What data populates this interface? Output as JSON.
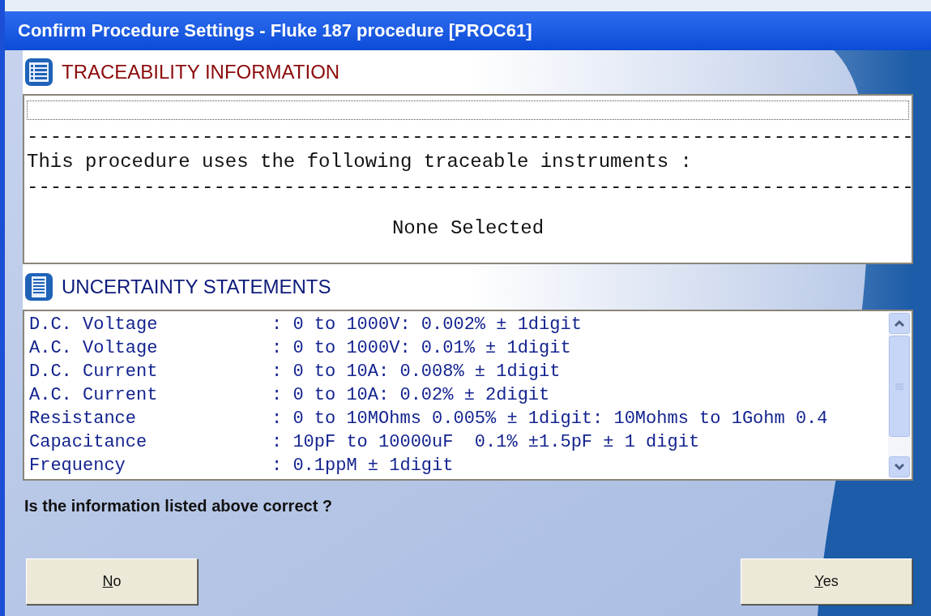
{
  "window": {
    "title": "Confirm Procedure Settings - Fluke 187 procedure [PROC61]"
  },
  "traceability": {
    "heading": "TRACEABILITY INFORMATION",
    "lines": [
      {
        "kind": "focus"
      },
      {
        "kind": "rule",
        "text": "----------------------------------------------------------------------------"
      },
      {
        "kind": "text",
        "text": "This procedure uses the following traceable instruments :"
      },
      {
        "kind": "rule",
        "text": "----------------------------------------------------------------------------"
      },
      {
        "kind": "center",
        "text": "None Selected"
      }
    ]
  },
  "uncertainty": {
    "heading": "UNCERTAINTY STATEMENTS",
    "rows": [
      {
        "label": "D.C. Voltage",
        "value": ": 0 to 1000V: 0.002% ± 1digit"
      },
      {
        "label": "A.C. Voltage",
        "value": ": 0 to 1000V: 0.01% ± 1digit"
      },
      {
        "label": "D.C. Current",
        "value": ": 0 to 10A: 0.008% ± 1digit"
      },
      {
        "label": "A.C. Current",
        "value": ": 0 to 10A: 0.02% ± 2digit"
      },
      {
        "label": "Resistance",
        "value": ": 0 to 10MOhms 0.005% ± 1digit: 10Mohms to 1Gohm 0.4"
      },
      {
        "label": "Capacitance",
        "value": ": 10pF to 10000uF  0.1% ±1.5pF ± 1 digit"
      },
      {
        "label": "Frequency",
        "value": ": 0.1ppM ± 1digit"
      }
    ]
  },
  "question": "Is the information listed above correct ?",
  "buttons": [
    {
      "access_key": "N",
      "rest": "o"
    },
    {
      "access_key": "Y",
      "rest": "es"
    }
  ]
}
